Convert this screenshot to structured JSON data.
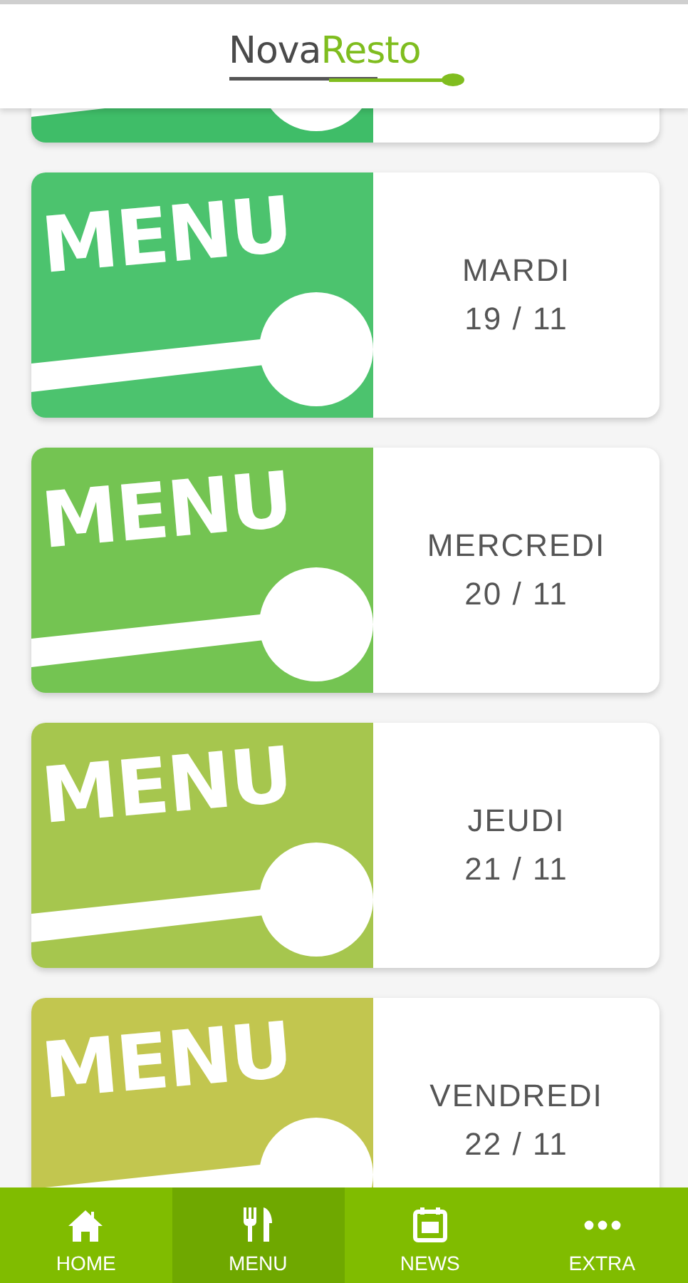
{
  "header": {
    "logo_part_1": "Nova",
    "logo_part_2": "Resto"
  },
  "cards": [
    {
      "color": "#3fbd68"
    },
    {
      "color": "#4cc36e",
      "banner": "MENU",
      "day": "MARDI",
      "date": "19 / 11"
    },
    {
      "color": "#74c452",
      "banner": "MENU",
      "day": "MERCREDI",
      "date": "20 / 11"
    },
    {
      "color": "#a6c64e",
      "banner": "MENU",
      "day": "JEUDI",
      "date": "21 / 11"
    },
    {
      "color": "#c2c64f",
      "banner": "MENU",
      "day": "VENDREDI",
      "date": "22 / 11"
    }
  ],
  "nav": [
    {
      "kind": "home",
      "label": "HOME",
      "selected": false
    },
    {
      "kind": "menu",
      "label": "MENU",
      "selected": true
    },
    {
      "kind": "news",
      "label": "NEWS",
      "selected": false
    },
    {
      "kind": "extra",
      "label": "EXTRA",
      "selected": false
    }
  ]
}
